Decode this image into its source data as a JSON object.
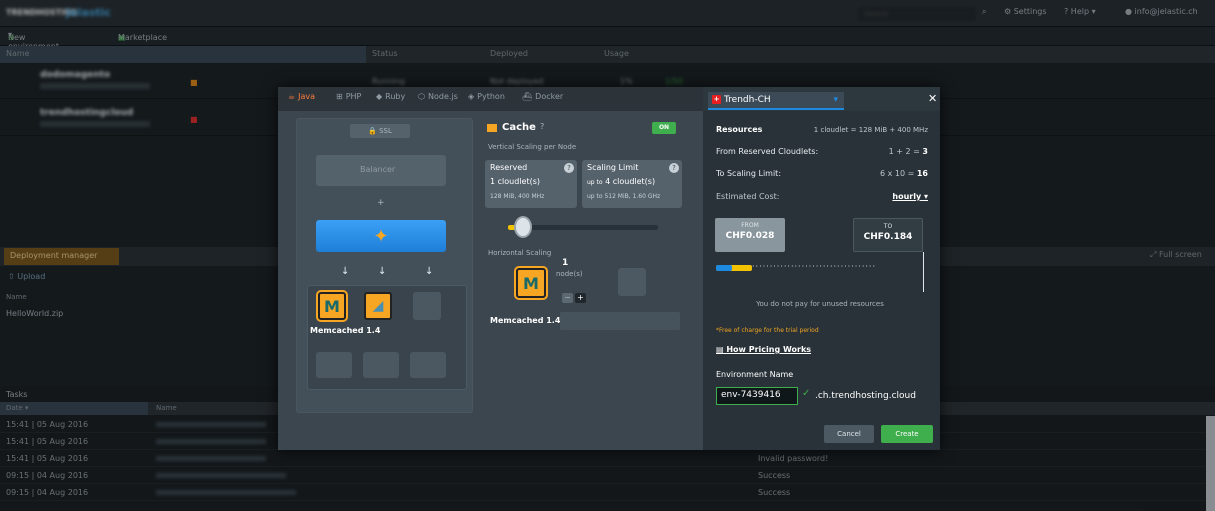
{
  "topbar": {
    "logo_main": "TRENDHOSTING",
    "logo_sub": "Jelastic",
    "search_placeholder": "Search",
    "settings": "Settings",
    "help": "Help",
    "user": "info@jelastic.ch"
  },
  "bar2": {
    "new_env": "New environment",
    "marketplace": "Marketplace"
  },
  "table_header": {
    "name": "Name",
    "status": "Status",
    "deployed": "Deployed",
    "usage": "Usage"
  },
  "envs": [
    {
      "name": "dodomagento",
      "status": "Running",
      "deployed": "Not deployed",
      "cpu": "1%",
      "mem": "1/50"
    },
    {
      "name": "trendhostingcloud",
      "status": "",
      "deployed": "",
      "cpu": "",
      "mem": ""
    }
  ],
  "deploy": {
    "tab": "Deployment manager",
    "upload": "Upload",
    "name": "Name",
    "file": "HelloWorld.zip",
    "fullscreen": "Full screen"
  },
  "tasks": {
    "title": "Tasks",
    "col_date": "Date",
    "col_name": "Name",
    "rows": [
      {
        "date": "15:41 | 05 Aug 2016",
        "result": ""
      },
      {
        "date": "15:41 | 05 Aug 2016",
        "result": ""
      },
      {
        "date": "15:41 | 05 Aug 2016",
        "result": "Invalid password!"
      },
      {
        "date": "09:15 | 04 Aug 2016",
        "result": "Success"
      },
      {
        "date": "09:15 | 04 Aug 2016",
        "result": "Success"
      }
    ]
  },
  "dialog": {
    "tabs": [
      "Java",
      "PHP",
      "Ruby",
      "Node.js",
      "Python",
      "Docker"
    ],
    "left": {
      "ssl": "SSL",
      "stack_label": "Memcached 1.4",
      "balancer": "Balancer"
    },
    "mid": {
      "title": "Cache",
      "toggle": "ON",
      "vsp": "Vertical Scaling per Node",
      "reserved_title": "Reserved",
      "reserved_val": "1",
      "reserved_unit": "cloudlet(s)",
      "reserved_sub": "128 MiB, 400 MHz",
      "limit_title": "Scaling Limit",
      "limit_prefix": "up to",
      "limit_val": "4",
      "limit_unit": "cloudlet(s)",
      "limit_sub": "up to 512 MiB, 1.60 GHz",
      "hs": "Horizontal Scaling",
      "nodes_num": "1",
      "nodes_lbl": "node(s)",
      "stack_label": "Memcached 1.4"
    },
    "right": {
      "region": "Trendh-CH",
      "resources": "Resources",
      "res_eq": "1 cloudlet = 128 MiB + 400 MHz",
      "from_reserved": "From Reserved Cloudlets:",
      "from_reserved_expr": "1 + 2 =",
      "from_reserved_total": "3",
      "to_limit": "To Scaling Limit:",
      "to_limit_expr": "6 x 10 =",
      "to_limit_total": "16",
      "est": "Estimated Cost:",
      "period": "hourly",
      "from_lbl": "FROM",
      "from_val": "CHF0.028",
      "to_lbl": "TO",
      "to_val": "CHF0.184",
      "unused": "You do not pay for unused resources",
      "free": "*Free of charge for the trial period",
      "how": "How Pricing Works",
      "env_name_lbl": "Environment Name",
      "env_name": "env-7439416",
      "domain": ".ch.trendhosting.cloud"
    },
    "cancel": "Cancel",
    "create": "Create"
  },
  "colors": {
    "accent": "#1d8ae0",
    "success": "#3fae4d",
    "warning": "#f2c200",
    "orange": "#ff7a3c"
  }
}
